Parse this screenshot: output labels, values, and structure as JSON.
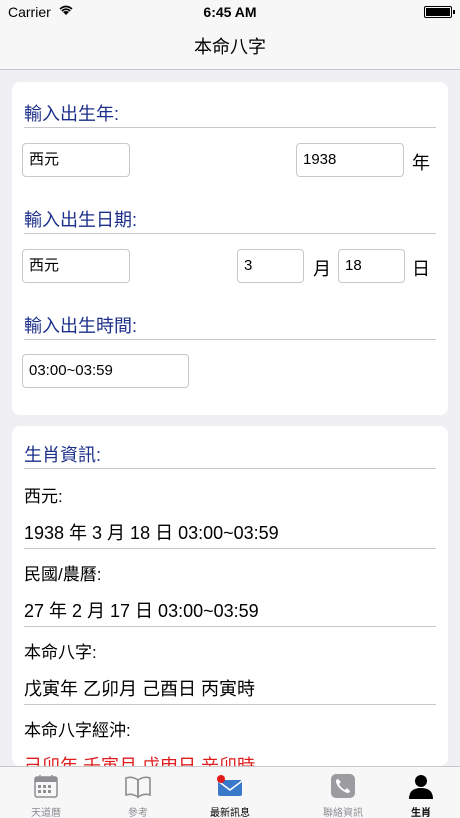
{
  "status": {
    "carrier": "Carrier",
    "time": "6:45 AM"
  },
  "nav": {
    "title": "本命八字"
  },
  "form": {
    "year_heading": "輸入出生年:",
    "year_era": "西元",
    "year_value": "1938",
    "year_unit": "年",
    "date_heading": "輸入出生日期:",
    "date_era": "西元",
    "month_value": "3",
    "month_unit": "月",
    "day_value": "18",
    "day_unit": "日",
    "time_heading": "輸入出生時間:",
    "time_value": "03:00~03:59"
  },
  "info": {
    "heading": "生肖資訊:",
    "western_label": "西元:",
    "western_value": "1938 年 3 月 18 日 03:00~03:59",
    "lunar_label": "民國/農曆:",
    "lunar_value": "27 年 2 月 17 日 03:00~03:59",
    "bazi_label": "本命八字:",
    "bazi_value": "戊寅年 乙卯月 己酉日 丙寅時",
    "clash_label": "本命八字經沖:",
    "clash_value": "己卯年 壬寅月 戊申日 辛卯時"
  },
  "tabs": [
    {
      "label": "天道曆",
      "icon": "calendar-icon"
    },
    {
      "label": "參考",
      "icon": "book-icon"
    },
    {
      "label": "最新訊息",
      "icon": "mail-icon"
    },
    {
      "label": "聯絡資訊",
      "icon": "phone-icon"
    },
    {
      "label": "生肖",
      "icon": "person-icon"
    }
  ],
  "colors": {
    "heading": "#1d2f8a",
    "clash": "#e01b1b",
    "background": "#efeff4"
  }
}
